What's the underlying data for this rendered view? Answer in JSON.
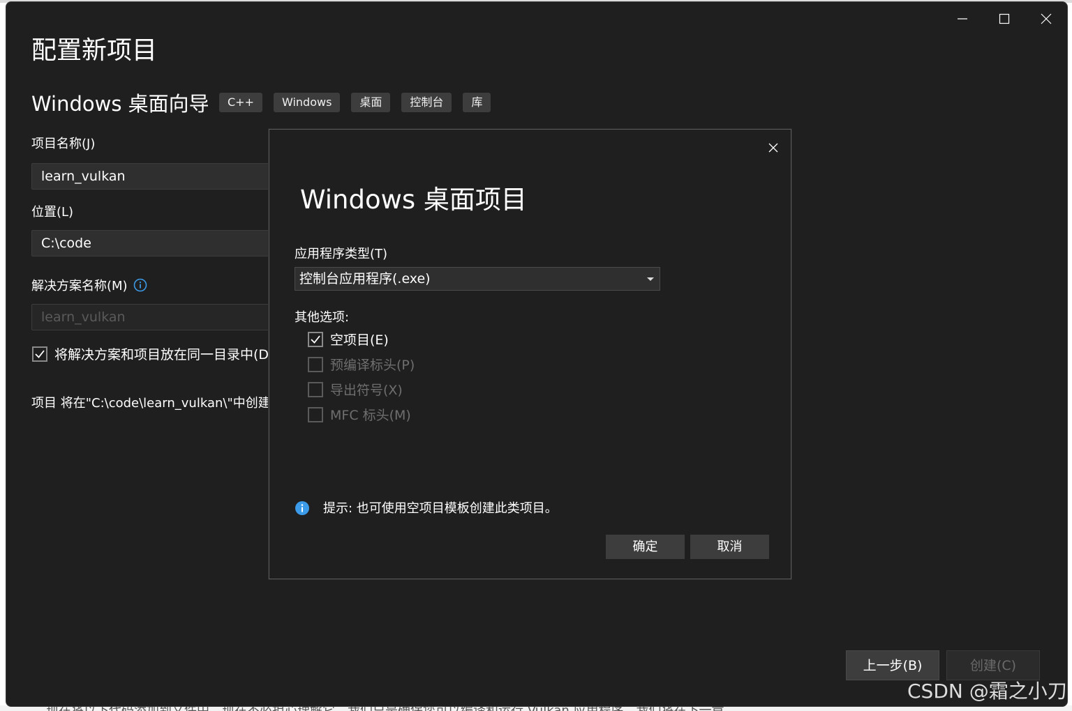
{
  "background": {
    "bottom_text": "现在将以下代码添加到文件中，现在不必担心理解它，我们只是确保您可以编译和运行 Vulkan 应用程序。我们将在下一章"
  },
  "window": {
    "page_title": "配置新项目",
    "subtitle": "Windows 桌面向导",
    "tags": [
      "C++",
      "Windows",
      "桌面",
      "控制台",
      "库"
    ],
    "project_name_label": "项目名称(J)",
    "project_name_value": "learn_vulkan",
    "location_label": "位置(L)",
    "location_value": "C:\\code",
    "solution_name_label": "解决方案名称(M)",
    "solution_name_value": "learn_vulkan",
    "same_dir_label": "将解决方案和项目放在同一目录中(D)",
    "same_dir_checked": true,
    "create_path_text": "项目 将在\"C:\\code\\learn_vulkan\\\"中创建",
    "back_button": "上一步(B)",
    "create_button": "创建(C)"
  },
  "dialog": {
    "title": "Windows 桌面项目",
    "app_type_label": "应用程序类型(T)",
    "app_type_value": "控制台应用程序(.exe)",
    "other_options_label": "其他选项:",
    "options": [
      {
        "label": "空项目(E)",
        "checked": true,
        "enabled": true
      },
      {
        "label": "预编译标头(P)",
        "checked": false,
        "enabled": false
      },
      {
        "label": "导出符号(X)",
        "checked": false,
        "enabled": false
      },
      {
        "label": "MFC 标头(M)",
        "checked": false,
        "enabled": false
      }
    ],
    "hint": "提示: 也可使用空项目模板创建此类项目。",
    "ok_button": "确定",
    "cancel_button": "取消"
  },
  "watermark": "CSDN @霜之小刀",
  "colors": {
    "window_bg": "#1f1f1f",
    "field_bg": "#2f2f2f",
    "button_bg": "#3d3d3d",
    "info_blue": "#3c9be8"
  }
}
